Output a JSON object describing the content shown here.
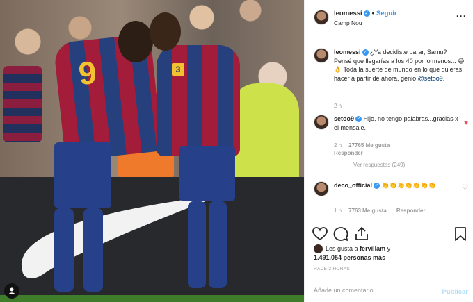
{
  "post": {
    "username": "leomessi",
    "follow_label": "Seguir",
    "separator": "•",
    "location": "Camp Nou",
    "more_icon": "more-options-icon"
  },
  "comments": [
    {
      "username": "leomessi",
      "text": "¿Ya decidiste parar, Samu? Pensé que llegarías a los 40 por lo menos... 😄👌 Toda la suerte de mundo en lo que quieras hacer a partir de ahora, genio",
      "mention": "@setoo9",
      "end": ".",
      "time": "2 h"
    },
    {
      "username": "setoo9",
      "text": "Hijo, no tengo palabras...gracias x el mensaje.",
      "time": "2 h",
      "likes": "27765 Me gusta",
      "reply": "Responder",
      "view_replies": "Ver respuestas (249)",
      "liked": true
    },
    {
      "username": "deco_official",
      "text": "👏👏👏👏👏👏👏",
      "time": "1 h",
      "likes": "7763 Me gusta",
      "reply": "Responder"
    }
  ],
  "likes": {
    "prefix": "Les gusta a",
    "user": "fervillam",
    "middle": "y",
    "count": "1.491.054 personas más"
  },
  "timestamp": "HACE 2 HORAS",
  "add_comment": {
    "placeholder": "Añade un comentario...",
    "publish_label": "Publicar"
  },
  "colors": {
    "accent": "#3897f0",
    "heart_red": "#ed4956",
    "muted": "#999999"
  }
}
